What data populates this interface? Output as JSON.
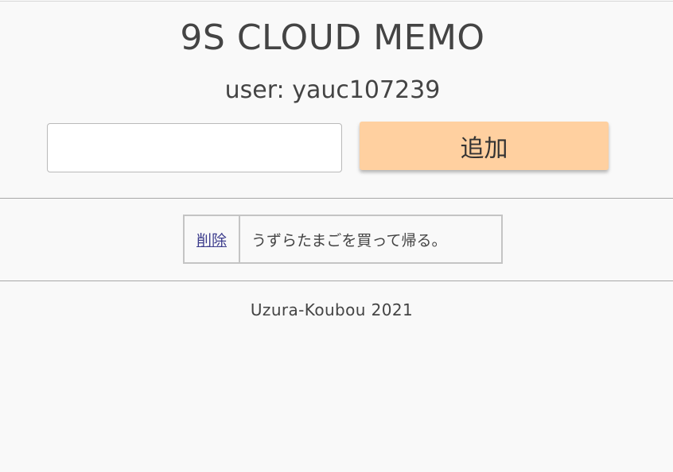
{
  "header": {
    "app_title": "9S CLOUD MEMO",
    "user_line": "user: yauc107239"
  },
  "form": {
    "input_value": "",
    "add_label": "追加"
  },
  "memos": [
    {
      "delete_label": "削除",
      "text": "うずらたまごを買って帰る。"
    }
  ],
  "footer": {
    "text": "Uzura-Koubou 2021"
  },
  "colors": {
    "background": "#f9f9f9",
    "add_button": "#ffd0a0",
    "link": "#3c3c8c"
  }
}
